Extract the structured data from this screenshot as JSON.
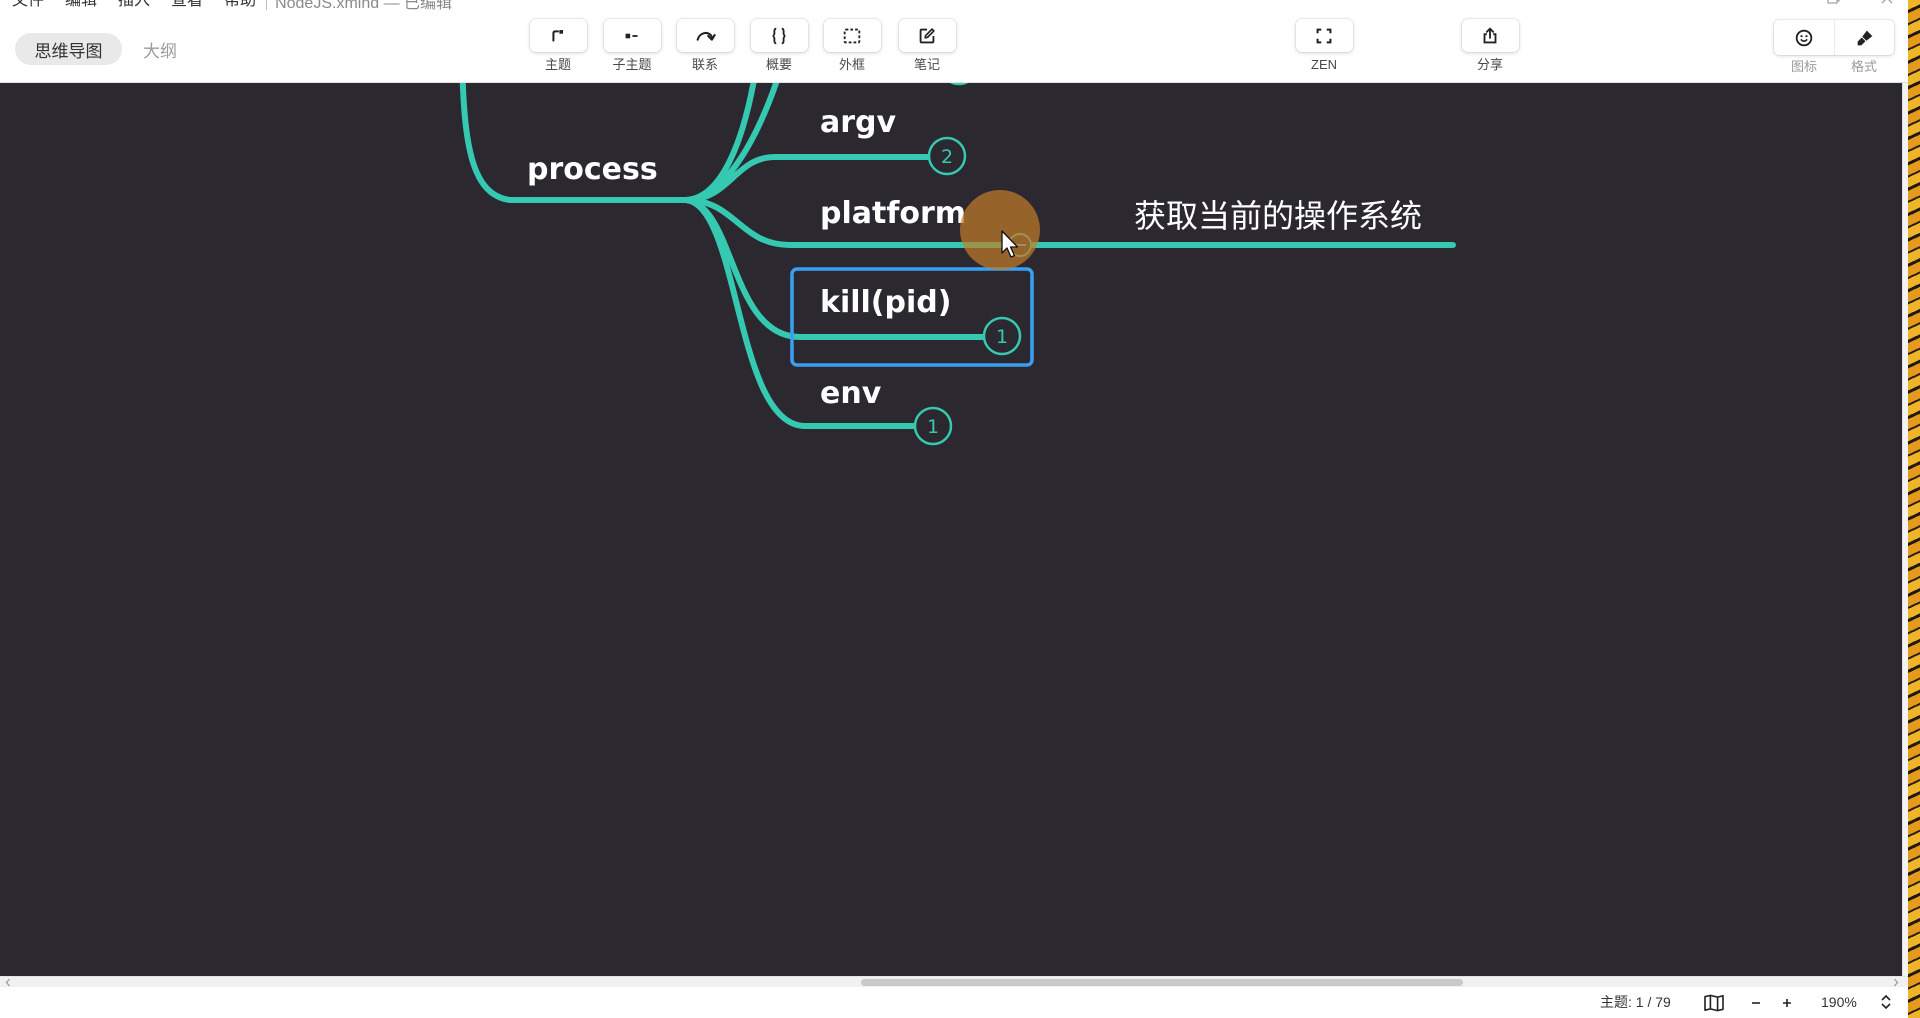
{
  "window": {
    "menu_items": [
      "文件",
      "编辑",
      "插入",
      "查看",
      "帮助"
    ],
    "document_title": "NodeJS.xmind — 已编辑",
    "controls": [
      "minimize-icon",
      "maximize-icon",
      "close-icon"
    ]
  },
  "view_tabs": [
    {
      "label": "思维导图",
      "active": true
    },
    {
      "label": "大纲",
      "active": false
    }
  ],
  "toolbar": {
    "topic": {
      "label": "主题",
      "icon": "topic-icon"
    },
    "subtopic": {
      "label": "子主题",
      "icon": "subtopic-icon"
    },
    "relationship": {
      "label": "联系",
      "icon": "relationship-icon"
    },
    "summary": {
      "label": "概要",
      "icon": "summary-icon"
    },
    "boundary": {
      "label": "外框",
      "icon": "boundary-icon"
    },
    "note": {
      "label": "笔记",
      "icon": "note-icon"
    },
    "zen": {
      "label": "ZEN",
      "icon": "fullscreen-icon"
    },
    "share": {
      "label": "分享",
      "icon": "share-icon"
    },
    "icons_panel": {
      "label": "图标",
      "icon": "smiley-icon"
    },
    "format_panel": {
      "label": "格式",
      "icon": "brush-icon"
    }
  },
  "mindmap": {
    "topic": "process",
    "subtopics": [
      {
        "label": "argv",
        "collapsed_count": "2"
      },
      {
        "label": "platform",
        "expanded": true,
        "children": [
          "获取当前的操作系统"
        ]
      },
      {
        "label": "kill(pid)",
        "collapsed_count": "1",
        "selected": true
      },
      {
        "label": "env",
        "collapsed_count": "1"
      }
    ]
  },
  "status_bar": {
    "topic_counter": "主题: 1 / 79",
    "zoom": "190%",
    "icons": [
      "book-icon",
      "zoom-out-icon",
      "zoom-in-icon",
      "chevron-up-down-icon"
    ]
  },
  "colors": {
    "canvas": "#2b2830",
    "branch": "#34c9b0",
    "selection": "#3a9ff2",
    "topic_text": "#ffffff",
    "cursor_highlight": "#c47e28"
  }
}
